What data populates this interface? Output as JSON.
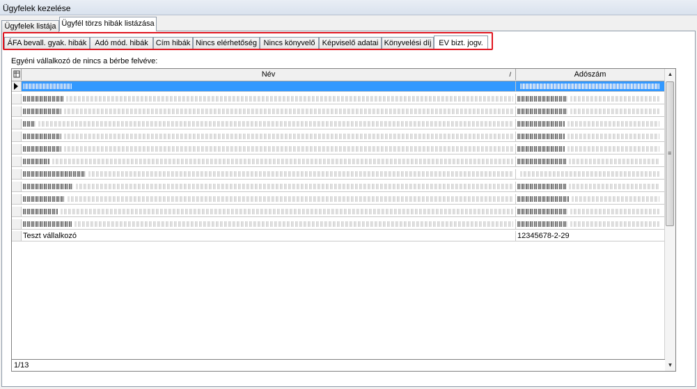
{
  "window": {
    "title": "Ügyfelek kezelése"
  },
  "top_tabs": [
    {
      "label": "Ügyfelek listája",
      "active": false
    },
    {
      "label": "Ügyfél törzs hibák listázása",
      "active": true
    }
  ],
  "sub_tabs": [
    {
      "label": "ÁFA bevall. gyak. hibák"
    },
    {
      "label": "Adó mód. hibák"
    },
    {
      "label": "Cím hibák"
    },
    {
      "label": "Nincs elérhetőség"
    },
    {
      "label": "Nincs könyvelő"
    },
    {
      "label": "Képviselő adatai"
    },
    {
      "label": "Könyvelési díj"
    },
    {
      "label": "EV bizt. jogv.",
      "active": true
    }
  ],
  "section_label": "Egyéni vállalkozó de nincs a bérbe felvéve:",
  "grid": {
    "columns": [
      "Név",
      "Adószám"
    ],
    "sort_indicator": "/",
    "last_row": {
      "nev": "Teszt vállalkozó",
      "adoszam": "12345678-2-29"
    },
    "record_counter": "1/13"
  },
  "scrollbar": {
    "up": "▲",
    "down": "▼",
    "grip": "≡"
  }
}
